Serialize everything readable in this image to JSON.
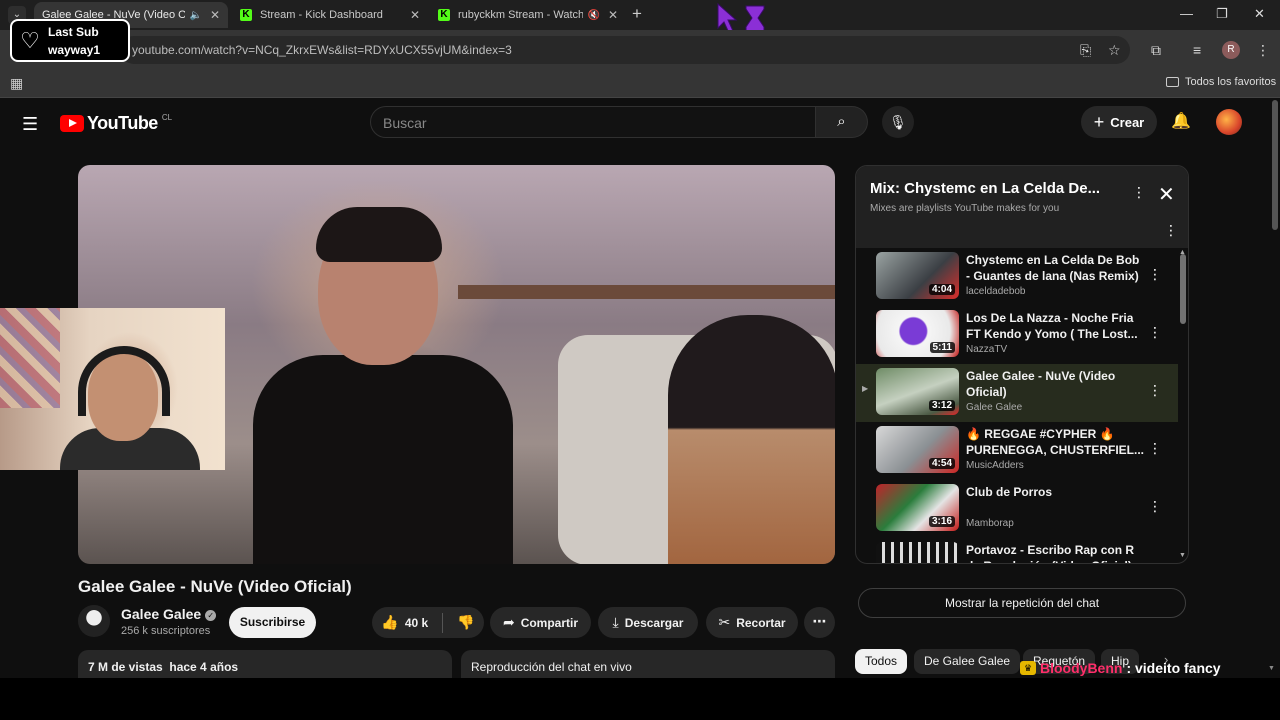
{
  "browser": {
    "tabs": [
      {
        "title": "Galee Galee - NuVe (Video O",
        "favicon": "youtube-favicon",
        "muted_icon": "🔈",
        "active": true
      },
      {
        "title": "Stream - Kick Dashboard",
        "favicon": "kick-favicon",
        "active": false
      },
      {
        "title": "rubyckkm Stream - Watch L",
        "favicon": "kick-favicon",
        "muted_icon": "🔇",
        "active": false
      }
    ],
    "new_tab": "+",
    "window_controls": {
      "minimize": "—",
      "maximize": "❐",
      "close": "✕"
    },
    "url": "youtube.com/watch?v=NCq_ZkrxEWs&list=RDYxUCX55vjUM&index=3",
    "profile_initial": "R",
    "bookmarks": {
      "all_bookmarks": "Todos los favoritos"
    },
    "kick_letter": "K"
  },
  "overlay_last_sub": {
    "title": "Last Sub",
    "name": "wayway1"
  },
  "youtube": {
    "logo_text": "YouTube",
    "country_code": "CL",
    "search_placeholder": "Buscar",
    "create_label": "Crear",
    "video": {
      "title": "Galee Galee - NuVe (Video Oficial)",
      "channel": "Galee Galee",
      "subscribers": "256 k suscriptores",
      "subscribe_label": "Suscribirse",
      "likes": "40 k",
      "share_label": "Compartir",
      "download_label": "Descargar",
      "clip_label": "Recortar",
      "views": "7 M de vistas",
      "age": "hace 4 años",
      "chat_replay": "Reproducción del chat en vivo"
    },
    "playlist": {
      "title": "Mix: Chystemc en La Celda De...",
      "subtitle": "Mixes are playlists YouTube makes for you",
      "items": [
        {
          "title": "Chystemc en La Celda De Bob - Guantes de lana (Nas Remix)",
          "channel": "laceldadebob",
          "duration": "4:04",
          "current": false
        },
        {
          "title": "Los De La Nazza - Noche Fria FT Kendo y Yomo ( The Lost...",
          "channel": "NazzaTV",
          "duration": "5:11",
          "current": false
        },
        {
          "title": "Galee Galee - NuVe (Video Oficial)",
          "channel": "Galee Galee",
          "duration": "3:12",
          "current": true
        },
        {
          "title": "🔥 REGGAE #CYPHER 🔥 PURENEGGA, CHUSTERFIEL...",
          "channel": "MusicAdders",
          "duration": "4:54",
          "current": false
        },
        {
          "title": "Club de Porros",
          "channel": "Mamborap",
          "duration": "3:16",
          "current": false
        },
        {
          "title": "Portavoz - Escribo Rap con R de Revolución (Video Oficial)",
          "channel": "",
          "duration": "",
          "current": false
        }
      ]
    },
    "show_chat_replay": "Mostrar la repetición del chat",
    "chips": [
      "Todos",
      "De Galee Galee",
      "Reguetón",
      "Hip"
    ]
  },
  "stream_chat": {
    "user": "BloodyBenn",
    "message": ": videito fancy"
  },
  "colors": {
    "youtube_red": "#ff0000",
    "kick_green": "#53fc18",
    "chat_user": "#ff2e6a",
    "current_item_bg": "#272c1e"
  }
}
